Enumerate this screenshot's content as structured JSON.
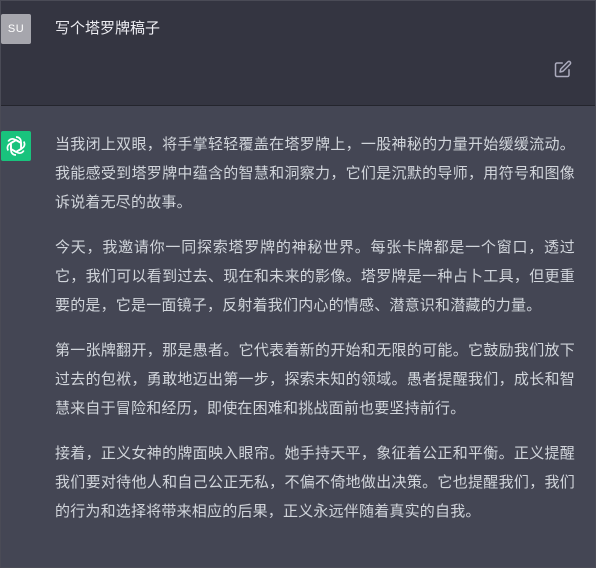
{
  "user_message": {
    "avatar_initials": "SU",
    "text": "写个塔罗牌稿子"
  },
  "assistant_message": {
    "paragraphs": [
      "当我闭上双眼，将手掌轻轻覆盖在塔罗牌上，一股神秘的力量开始缓缓流动。我能感受到塔罗牌中蕴含的智慧和洞察力，它们是沉默的导师，用符号和图像诉说着无尽的故事。",
      "今天，我邀请你一同探索塔罗牌的神秘世界。每张卡牌都是一个窗口，透过它，我们可以看到过去、现在和未来的影像。塔罗牌是一种占卜工具，但更重要的是，它是一面镜子，反射着我们内心的情感、潜意识和潜藏的力量。",
      "第一张牌翻开，那是愚者。它代表着新的开始和无限的可能。它鼓励我们放下过去的包袱，勇敢地迈出第一步，探索未知的领域。愚者提醒我们，成长和智慧来自于冒险和经历，即使在困难和挑战面前也要坚持前行。",
      "接着，正义女神的牌面映入眼帘。她手持天平，象征着公正和平衡。正义提醒我们要对待他人和自己公正无私，不偏不倚地做出决策。它也提醒我们，我们的行为和选择将带来相应的后果，正义永远伴随着真实的自我。"
    ]
  },
  "icons": {
    "edit": "edit-icon",
    "assistant_logo": "openai-logo-icon"
  },
  "colors": {
    "user_bg": "#343541",
    "assistant_bg": "#444654",
    "user_avatar_bg": "#a6a6ad",
    "assistant_avatar_bg": "#19c37d",
    "text": "#d1d5db"
  }
}
